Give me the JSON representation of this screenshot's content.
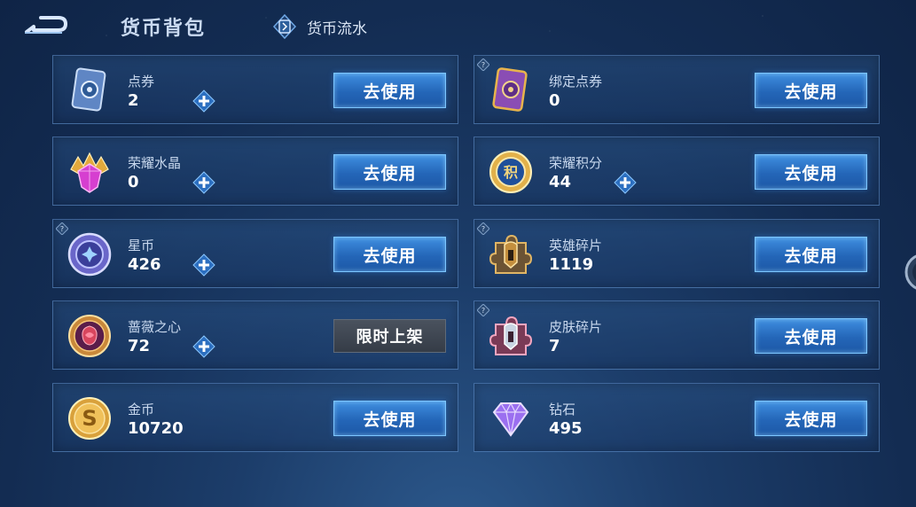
{
  "header": {
    "title": "货币背包",
    "flow_tab_label": "货币流水"
  },
  "currencies": [
    {
      "name": "点券",
      "count": "2",
      "action": "去使用",
      "has_plus": true,
      "has_help": false,
      "icon": "voucher-card-icon"
    },
    {
      "name": "绑定点券",
      "count": "0",
      "action": "去使用",
      "has_plus": false,
      "has_help": true,
      "icon": "bound-voucher-card-icon"
    },
    {
      "name": "荣耀水晶",
      "count": "0",
      "action": "去使用",
      "has_plus": true,
      "has_help": false,
      "icon": "glory-crystal-icon"
    },
    {
      "name": "荣耀积分",
      "count": "44",
      "action": "去使用",
      "has_plus": true,
      "has_help": false,
      "icon": "glory-points-icon"
    },
    {
      "name": "星币",
      "count": "426",
      "action": "去使用",
      "has_plus": true,
      "has_help": true,
      "icon": "star-coin-icon"
    },
    {
      "name": "英雄碎片",
      "count": "1119",
      "action": "去使用",
      "has_plus": false,
      "has_help": true,
      "icon": "hero-fragment-icon"
    },
    {
      "name": "蔷薇之心",
      "count": "72",
      "action": "限时上架",
      "has_plus": true,
      "has_help": false,
      "icon": "rose-heart-icon"
    },
    {
      "name": "皮肤碎片",
      "count": "7",
      "action": "去使用",
      "has_plus": false,
      "has_help": true,
      "icon": "skin-fragment-icon"
    },
    {
      "name": "金币",
      "count": "10720",
      "action": "去使用",
      "has_plus": false,
      "has_help": false,
      "icon": "gold-coin-icon"
    },
    {
      "name": "钻石",
      "count": "495",
      "action": "去使用",
      "has_plus": false,
      "has_help": false,
      "icon": "diamond-icon"
    }
  ],
  "colors": {
    "accent_blue": "#2466b8",
    "button_border": "#7cc6ff",
    "disabled_button": "#353c47",
    "gold": "#e2b14a"
  }
}
